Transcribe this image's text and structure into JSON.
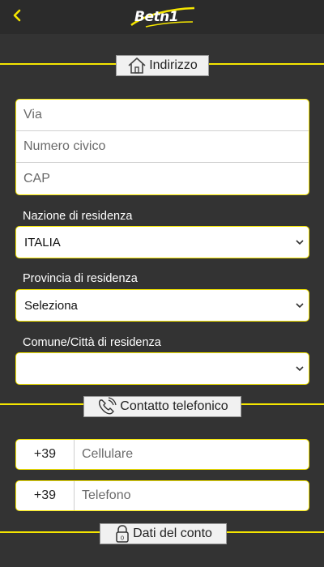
{
  "header": {
    "back_icon": "chevron-left-icon",
    "logo_text": "Betn1",
    "accent_color": "#f5e600"
  },
  "address_section": {
    "title": "Indirizzo",
    "icon": "house-icon",
    "fields": {
      "via_placeholder": "Via",
      "civico_placeholder": "Numero civico",
      "cap_placeholder": "CAP"
    },
    "nazione": {
      "label": "Nazione di residenza",
      "value": "ITALIA"
    },
    "provincia": {
      "label": "Provincia di residenza",
      "value": "Seleziona"
    },
    "comune": {
      "label": "Comune/Città di residenza",
      "value": ""
    }
  },
  "contact_section": {
    "title": "Contatto telefonico",
    "icon": "phone-icon",
    "cellulare": {
      "prefix": "+39",
      "placeholder": "Cellulare"
    },
    "telefono": {
      "prefix": "+39",
      "placeholder": "Telefono"
    }
  },
  "account_section": {
    "title": "Dati del conto",
    "icon": "lock-icon"
  }
}
